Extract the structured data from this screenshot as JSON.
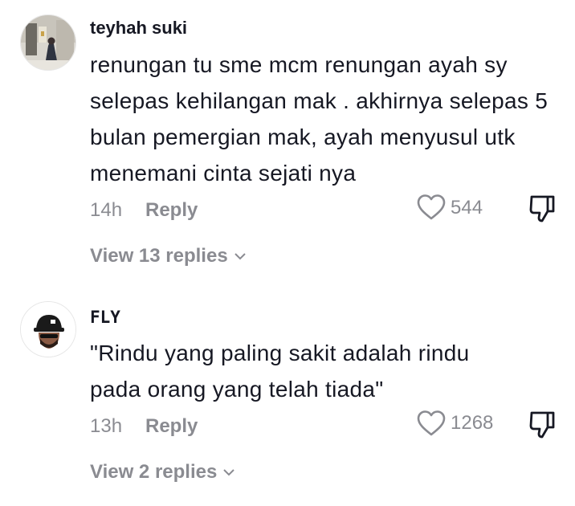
{
  "comments": [
    {
      "username": "teyhah suki",
      "text": "renungan tu sme mcm renungan ayah sy selepas kehilangan mak . akhirnya selepas 5 bulan pemergian mak, ayah menyusul utk menemani cinta sejati nya",
      "time": "14h",
      "reply_label": "Reply",
      "likes": "544",
      "view_replies": "View 13 replies",
      "avatar_icon": "photo-avatar"
    },
    {
      "username": "FLY",
      "text": "\"Rindu yang paling sakit adalah rindu pada orang yang telah tiada\"",
      "time": "13h",
      "reply_label": "Reply",
      "likes": "1268",
      "view_replies": "View 2 replies",
      "avatar_icon": "cap-man-avatar"
    }
  ],
  "colors": {
    "text": "#161823",
    "muted": "#8a8b91"
  }
}
